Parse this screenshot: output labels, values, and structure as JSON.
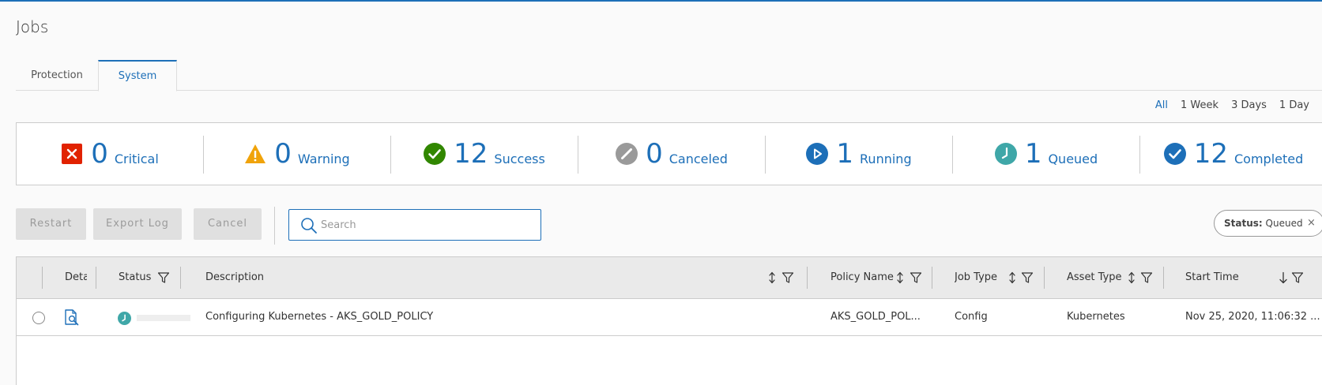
{
  "page": {
    "title": "Jobs"
  },
  "tabs": [
    {
      "label": "Protection",
      "active": false
    },
    {
      "label": "System",
      "active": true
    }
  ],
  "time_ranges": [
    {
      "label": "All",
      "active": true
    },
    {
      "label": "1 Week",
      "active": false
    },
    {
      "label": "3 Days",
      "active": false
    },
    {
      "label": "1 Day",
      "active": false
    }
  ],
  "summary": [
    {
      "count": "0",
      "label": "Critical",
      "icon": "critical-icon",
      "color": "#e12200"
    },
    {
      "count": "0",
      "label": "Warning",
      "icon": "warning-icon",
      "color": "#f0a30a"
    },
    {
      "count": "12",
      "label": "Success",
      "icon": "success-icon",
      "color": "#318700"
    },
    {
      "count": "0",
      "label": "Canceled",
      "icon": "canceled-icon",
      "color": "#9a9a9a"
    },
    {
      "count": "1",
      "label": "Running",
      "icon": "running-icon",
      "color": "#1d6fb8"
    },
    {
      "count": "1",
      "label": "Queued",
      "icon": "queued-icon",
      "color": "#3fa7a8"
    },
    {
      "count": "12",
      "label": "Completed",
      "icon": "completed-icon",
      "color": "#1d6fb8"
    }
  ],
  "toolbar": {
    "restart_label": "Restart",
    "export_label": "Export Log",
    "cancel_label": "Cancel",
    "search_placeholder": "Search",
    "search_value": ""
  },
  "filter_chip": {
    "key": "Status:",
    "value": "Queued",
    "close": "×"
  },
  "table": {
    "columns": {
      "details": "Deta",
      "status": "Status",
      "description": "Description",
      "policy_name": "Policy Name",
      "job_type": "Job Type",
      "asset_type": "Asset Type",
      "start_time": "Start Time"
    },
    "rows": [
      {
        "description": "Configuring Kubernetes - AKS_GOLD_POLICY",
        "policy_name": "AKS_GOLD_POL...",
        "job_type": "Config",
        "asset_type": "Kubernetes",
        "start_time": "Nov 25, 2020, 11:06:32 ...",
        "status_icon": "queued-icon",
        "progress": 0
      }
    ]
  },
  "colors": {
    "accent": "#1d6fb8",
    "critical": "#e12200",
    "warning": "#f0a30a",
    "success": "#318700",
    "canceled": "#9a9a9a",
    "queued": "#3fa7a8"
  }
}
